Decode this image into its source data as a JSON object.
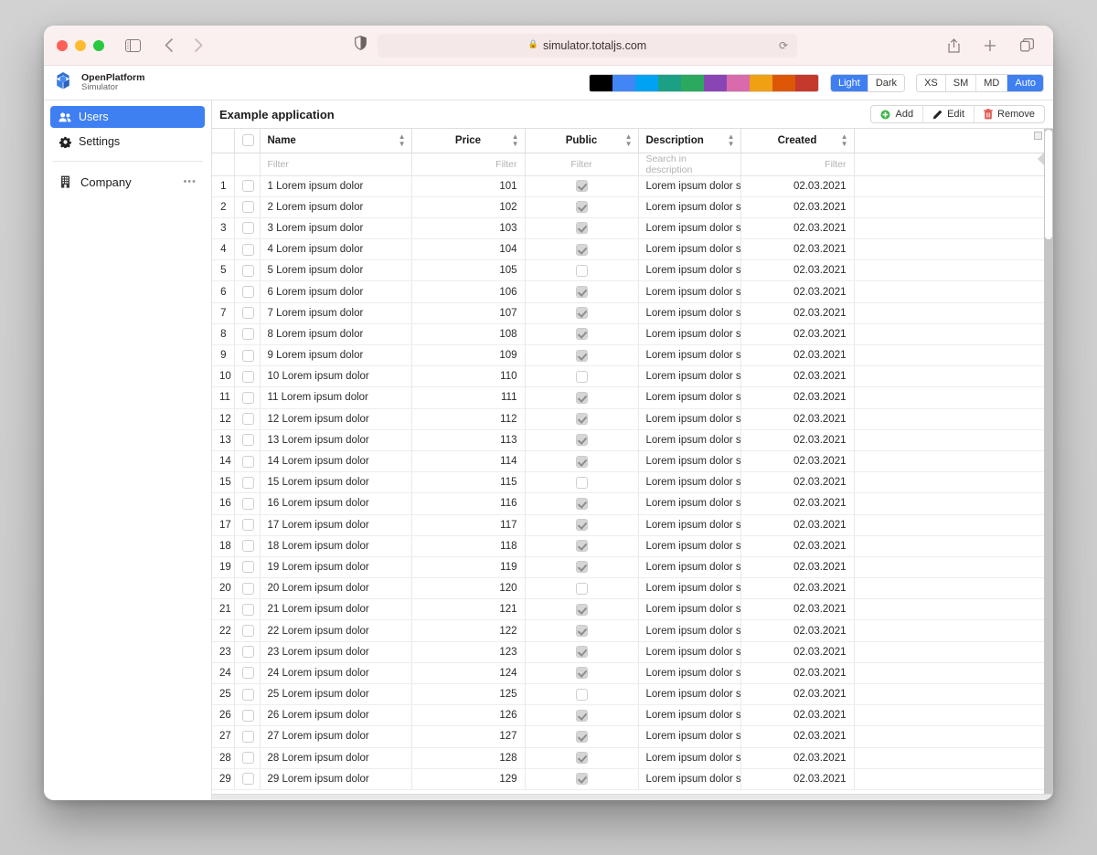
{
  "browser": {
    "url": "simulator.totaljs.com",
    "lock_icon": "lock-icon",
    "reload_icon": "reload-icon",
    "back_icon": "back-arrow-icon",
    "forward_icon": "forward-arrow-icon",
    "sidebar_icon": "sidebar-toggle-icon",
    "shield_icon": "shield-icon",
    "share_icon": "share-icon",
    "newtab_icon": "plus-icon",
    "tabs_icon": "tabs-overview-icon"
  },
  "header": {
    "brand_name": "OpenPlatform",
    "brand_sub": "Simulator",
    "logo_icon": "openplatform-logo-icon",
    "palette": [
      "#000000",
      "#4285f4",
      "#00a2f4",
      "#1ba085",
      "#2aa95f",
      "#8a45b5",
      "#d96bad",
      "#f0a013",
      "#de5706",
      "#c5382c"
    ],
    "palette_selected_index": 1,
    "theme_buttons": [
      {
        "label": "Light",
        "active": true
      },
      {
        "label": "Dark",
        "active": false
      }
    ],
    "size_buttons": [
      {
        "label": "XS",
        "active": false
      },
      {
        "label": "SM",
        "active": false
      },
      {
        "label": "MD",
        "active": false
      },
      {
        "label": "Auto",
        "active": true
      }
    ]
  },
  "sidebar": {
    "items": [
      {
        "label": "Users",
        "icon": "users-icon",
        "active": true
      },
      {
        "label": "Settings",
        "icon": "gear-icon",
        "active": false
      }
    ],
    "group": {
      "label": "Company",
      "icon": "building-icon",
      "more_icon": "ellipsis-icon"
    }
  },
  "main": {
    "page_title": "Example application",
    "actions": [
      {
        "label": "Add",
        "icon": "plus-circle-icon",
        "color": "#3cb54a"
      },
      {
        "label": "Edit",
        "icon": "pencil-icon",
        "color": "#222222"
      },
      {
        "label": "Remove",
        "icon": "trash-icon",
        "color": "#e0544a"
      }
    ],
    "table": {
      "columns": [
        {
          "key": "num",
          "label": "",
          "align": "right",
          "sortable": false
        },
        {
          "key": "check",
          "label": "",
          "align": "center",
          "sortable": false
        },
        {
          "key": "name",
          "label": "Name",
          "align": "left",
          "sortable": true
        },
        {
          "key": "price",
          "label": "Price",
          "align": "center",
          "sortable": true
        },
        {
          "key": "public",
          "label": "Public",
          "align": "center",
          "sortable": true
        },
        {
          "key": "description",
          "label": "Description",
          "align": "left",
          "sortable": true
        },
        {
          "key": "created",
          "label": "Created",
          "align": "center",
          "sortable": true
        }
      ],
      "filters": {
        "name": "Filter",
        "price": "Filter",
        "public": "Filter",
        "description": "Search in description",
        "created": "Filter"
      },
      "header_select_all": false,
      "rows": [
        {
          "num": "1",
          "name": "1 Lorem ipsum dolor",
          "price": "101",
          "public": true,
          "description": "Lorem ipsum dolor sit ...",
          "created": "02.03.2021"
        },
        {
          "num": "2",
          "name": "2 Lorem ipsum dolor",
          "price": "102",
          "public": true,
          "description": "Lorem ipsum dolor sit ...",
          "created": "02.03.2021"
        },
        {
          "num": "3",
          "name": "3 Lorem ipsum dolor",
          "price": "103",
          "public": true,
          "description": "Lorem ipsum dolor sit ...",
          "created": "02.03.2021"
        },
        {
          "num": "4",
          "name": "4 Lorem ipsum dolor",
          "price": "104",
          "public": true,
          "description": "Lorem ipsum dolor sit ...",
          "created": "02.03.2021"
        },
        {
          "num": "5",
          "name": "5 Lorem ipsum dolor",
          "price": "105",
          "public": false,
          "description": "Lorem ipsum dolor sit ...",
          "created": "02.03.2021"
        },
        {
          "num": "6",
          "name": "6 Lorem ipsum dolor",
          "price": "106",
          "public": true,
          "description": "Lorem ipsum dolor sit ...",
          "created": "02.03.2021"
        },
        {
          "num": "7",
          "name": "7 Lorem ipsum dolor",
          "price": "107",
          "public": true,
          "description": "Lorem ipsum dolor sit ...",
          "created": "02.03.2021"
        },
        {
          "num": "8",
          "name": "8 Lorem ipsum dolor",
          "price": "108",
          "public": true,
          "description": "Lorem ipsum dolor sit ...",
          "created": "02.03.2021"
        },
        {
          "num": "9",
          "name": "9 Lorem ipsum dolor",
          "price": "109",
          "public": true,
          "description": "Lorem ipsum dolor sit ...",
          "created": "02.03.2021"
        },
        {
          "num": "10",
          "name": "10 Lorem ipsum dolor",
          "price": "110",
          "public": false,
          "description": "Lorem ipsum dolor sit ...",
          "created": "02.03.2021"
        },
        {
          "num": "11",
          "name": "11 Lorem ipsum dolor",
          "price": "111",
          "public": true,
          "description": "Lorem ipsum dolor sit ...",
          "created": "02.03.2021"
        },
        {
          "num": "12",
          "name": "12 Lorem ipsum dolor",
          "price": "112",
          "public": true,
          "description": "Lorem ipsum dolor sit ...",
          "created": "02.03.2021"
        },
        {
          "num": "13",
          "name": "13 Lorem ipsum dolor",
          "price": "113",
          "public": true,
          "description": "Lorem ipsum dolor sit ...",
          "created": "02.03.2021"
        },
        {
          "num": "14",
          "name": "14 Lorem ipsum dolor",
          "price": "114",
          "public": true,
          "description": "Lorem ipsum dolor sit ...",
          "created": "02.03.2021"
        },
        {
          "num": "15",
          "name": "15 Lorem ipsum dolor",
          "price": "115",
          "public": false,
          "description": "Lorem ipsum dolor sit ...",
          "created": "02.03.2021"
        },
        {
          "num": "16",
          "name": "16 Lorem ipsum dolor",
          "price": "116",
          "public": true,
          "description": "Lorem ipsum dolor sit ...",
          "created": "02.03.2021"
        },
        {
          "num": "17",
          "name": "17 Lorem ipsum dolor",
          "price": "117",
          "public": true,
          "description": "Lorem ipsum dolor sit ...",
          "created": "02.03.2021"
        },
        {
          "num": "18",
          "name": "18 Lorem ipsum dolor",
          "price": "118",
          "public": true,
          "description": "Lorem ipsum dolor sit ...",
          "created": "02.03.2021"
        },
        {
          "num": "19",
          "name": "19 Lorem ipsum dolor",
          "price": "119",
          "public": true,
          "description": "Lorem ipsum dolor sit ...",
          "created": "02.03.2021"
        },
        {
          "num": "20",
          "name": "20 Lorem ipsum dolor",
          "price": "120",
          "public": false,
          "description": "Lorem ipsum dolor sit ...",
          "created": "02.03.2021"
        },
        {
          "num": "21",
          "name": "21 Lorem ipsum dolor",
          "price": "121",
          "public": true,
          "description": "Lorem ipsum dolor sit ...",
          "created": "02.03.2021"
        },
        {
          "num": "22",
          "name": "22 Lorem ipsum dolor",
          "price": "122",
          "public": true,
          "description": "Lorem ipsum dolor sit ...",
          "created": "02.03.2021"
        },
        {
          "num": "23",
          "name": "23 Lorem ipsum dolor",
          "price": "123",
          "public": true,
          "description": "Lorem ipsum dolor sit ...",
          "created": "02.03.2021"
        },
        {
          "num": "24",
          "name": "24 Lorem ipsum dolor",
          "price": "124",
          "public": true,
          "description": "Lorem ipsum dolor sit ...",
          "created": "02.03.2021"
        },
        {
          "num": "25",
          "name": "25 Lorem ipsum dolor",
          "price": "125",
          "public": false,
          "description": "Lorem ipsum dolor sit ...",
          "created": "02.03.2021"
        },
        {
          "num": "26",
          "name": "26 Lorem ipsum dolor",
          "price": "126",
          "public": true,
          "description": "Lorem ipsum dolor sit ...",
          "created": "02.03.2021"
        },
        {
          "num": "27",
          "name": "27 Lorem ipsum dolor",
          "price": "127",
          "public": true,
          "description": "Lorem ipsum dolor sit ...",
          "created": "02.03.2021"
        },
        {
          "num": "28",
          "name": "28 Lorem ipsum dolor",
          "price": "128",
          "public": true,
          "description": "Lorem ipsum dolor sit ...",
          "created": "02.03.2021"
        },
        {
          "num": "29",
          "name": "29 Lorem ipsum dolor",
          "price": "129",
          "public": true,
          "description": "Lorem ipsum dolor sit ...",
          "created": "02.03.2021"
        }
      ]
    }
  }
}
